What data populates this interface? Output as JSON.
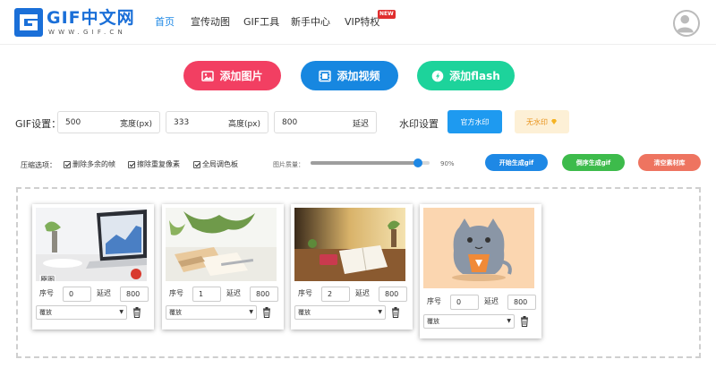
{
  "header": {
    "logo": {
      "title": "GIF中文网",
      "subtitle": "WWW.GIF.CN"
    },
    "nav": [
      {
        "label": "首页",
        "active": true
      },
      {
        "label": "宣传动图",
        "active": false
      },
      {
        "label": "GIF工具",
        "active": false
      },
      {
        "label": "新手中心",
        "active": false
      },
      {
        "label": "VIP特权",
        "active": false
      }
    ],
    "vip_badge": "NEW",
    "avatar_icon": "user-avatar-icon"
  },
  "actions": [
    {
      "label": "添加图片",
      "icon": "image-icon",
      "color": "#f23f62"
    },
    {
      "label": "添加视频",
      "icon": "film-icon",
      "color": "#1787e0"
    },
    {
      "label": "添加flash",
      "icon": "flash-icon",
      "color": "#1dd39b"
    }
  ],
  "gif_settings": {
    "label": "GIF设置：",
    "width": {
      "value": "500",
      "suffix": "宽度(px)"
    },
    "height": {
      "value": "333",
      "suffix": "高度(px)"
    },
    "delay": {
      "value": "800",
      "suffix": "延迟"
    }
  },
  "watermark": {
    "label": "水印设置",
    "official": "官方水印",
    "none": "无水印",
    "none_icon": "diamond-icon"
  },
  "compression": {
    "label": "压缩选项：",
    "options": [
      {
        "label": "删除多余的帧",
        "checked": true
      },
      {
        "label": "擦除重复像素",
        "checked": true
      },
      {
        "label": "全局调色板",
        "checked": true
      }
    ],
    "quality_label": "图片质量：",
    "quality_value": 0.9,
    "quality_text": "90%"
  },
  "buttons": {
    "start": "开始生成gif",
    "reverse": "倒序生成gif",
    "clear": "清空素材库",
    "colors": {
      "start": "#1e88e5",
      "reverse": "#3dbb4b",
      "clear": "#ee7460"
    }
  },
  "frames": [
    {
      "order": "0",
      "delay": "800",
      "mode": "覆放",
      "tag": "原图",
      "scene": "laptop"
    },
    {
      "order": "1",
      "delay": "800",
      "mode": "覆放",
      "tag": "",
      "scene": "desk"
    },
    {
      "order": "2",
      "delay": "800",
      "mode": "覆放",
      "tag": "",
      "scene": "notebook"
    },
    {
      "order": "0",
      "delay": "800",
      "mode": "覆放",
      "tag": "",
      "scene": "cat"
    }
  ],
  "frame_labels": {
    "order": "序号",
    "delay": "延迟"
  }
}
